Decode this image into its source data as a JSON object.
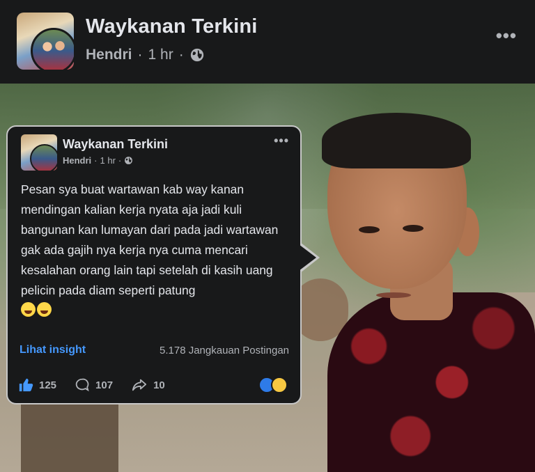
{
  "header": {
    "page_name": "Waykanan Terkini",
    "author": "Hendri",
    "separator": "·",
    "time": "1 hr",
    "privacy_icon": "globe-icon",
    "more_icon": "more-options-icon",
    "more_glyph": "•••"
  },
  "embedded_post": {
    "page_name": "Waykanan Terkini",
    "author": "Hendri",
    "separator": "·",
    "time": "1 hr",
    "privacy_icon": "globe-icon",
    "more_glyph": "•••",
    "body": "Pesan sya buat wartawan kab way kanan mendingan kalian kerja nyata aja jadi kuli bangunan kan lumayan dari pada jadi wartawan gak ada  gajih nya kerja nya cuma mencari kesalahan orang lain tapi setelah di kasih uang pelicin pada diam seperti patung",
    "emojis": [
      "rolling-on-floor-laughing",
      "rolling-on-floor-laughing"
    ],
    "insight_link": "Lihat insight",
    "reach": "5.178 Jangkauan Postingan",
    "likes": "125",
    "comments": "107",
    "shares": "10",
    "reaction_icons": [
      "like-reaction-icon",
      "haha-reaction-icon"
    ]
  },
  "colors": {
    "background": "#18191a",
    "text_primary": "#e4e6eb",
    "text_secondary": "#b0b3b8",
    "link": "#4599ff",
    "card_border": "#c8c8c8"
  }
}
